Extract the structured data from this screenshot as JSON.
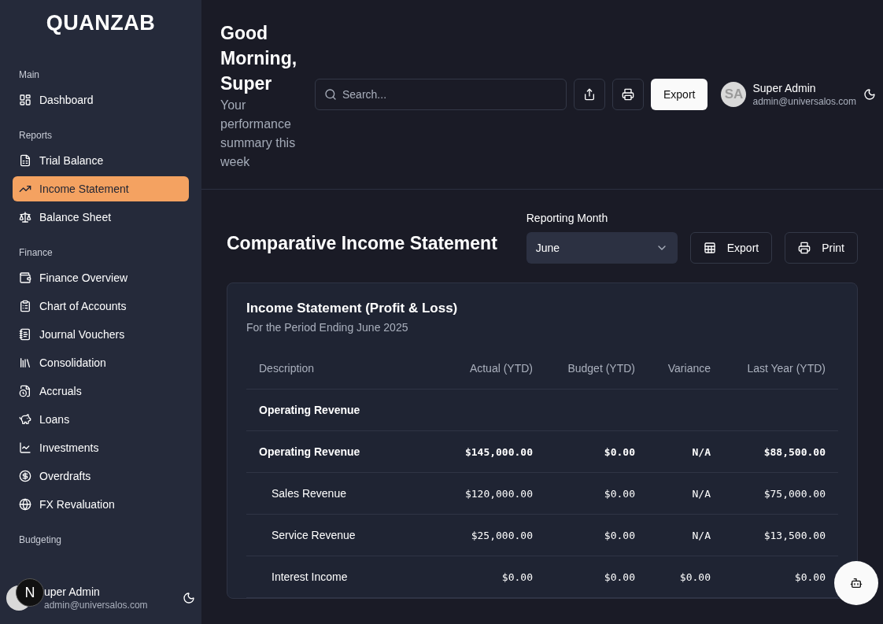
{
  "sidebar": {
    "logo": "QUANZAB",
    "sections": [
      {
        "title": "Main",
        "items": [
          {
            "label": "Dashboard",
            "selected": false
          }
        ]
      },
      {
        "title": "Reports",
        "items": [
          {
            "label": "Trial Balance",
            "selected": false
          },
          {
            "label": "Income Statement",
            "selected": true
          },
          {
            "label": "Balance Sheet",
            "selected": false
          }
        ]
      },
      {
        "title": "Finance",
        "items": [
          {
            "label": "Finance Overview",
            "selected": false
          },
          {
            "label": "Chart of Accounts",
            "selected": false
          },
          {
            "label": "Journal Vouchers",
            "selected": false
          },
          {
            "label": "Consolidation",
            "selected": false
          },
          {
            "label": "Accruals",
            "selected": false
          },
          {
            "label": "Loans",
            "selected": false
          },
          {
            "label": "Investments",
            "selected": false
          },
          {
            "label": "Overdrafts",
            "selected": false
          },
          {
            "label": "FX Revaluation",
            "selected": false
          }
        ]
      },
      {
        "title": "Budgeting"
      }
    ],
    "user": {
      "name": "uper Admin",
      "email": "admin@universalos.com"
    },
    "badge": "N"
  },
  "header": {
    "greeting": "Good Morning, Super",
    "subtitle": "Your performance summary this week",
    "search": {
      "placeholder": "Search..."
    },
    "export_label": "Export",
    "user": {
      "initials": "SA",
      "name": "Super Admin",
      "email": "admin@universalos.com"
    }
  },
  "page": {
    "title": "Comparative Income Statement",
    "month_label": "Reporting Month",
    "month": "June",
    "export_label": "Export",
    "print_label": "Print"
  },
  "card": {
    "title": "Income Statement (Profit & Loss)",
    "subtitle": "For the Period Ending June 2025",
    "columns": [
      "Description",
      "Actual (YTD)",
      "Budget (YTD)",
      "Variance",
      "Last Year (YTD)"
    ],
    "rows": [
      {
        "kind": "section",
        "cells": [
          "Operating Revenue"
        ]
      },
      {
        "kind": "total",
        "cells": [
          "Operating Revenue",
          "$145,000.00",
          "$0.00",
          "N/A",
          "$88,500.00"
        ]
      },
      {
        "kind": "item",
        "cells": [
          "Sales Revenue",
          "$120,000.00",
          "$0.00",
          "N/A",
          "$75,000.00"
        ]
      },
      {
        "kind": "item",
        "cells": [
          "Service Revenue",
          "$25,000.00",
          "$0.00",
          "N/A",
          "$13,500.00"
        ]
      },
      {
        "kind": "item",
        "cells": [
          "Interest Income",
          "$0.00",
          "$0.00",
          "$0.00",
          "$0.00"
        ]
      }
    ]
  }
}
